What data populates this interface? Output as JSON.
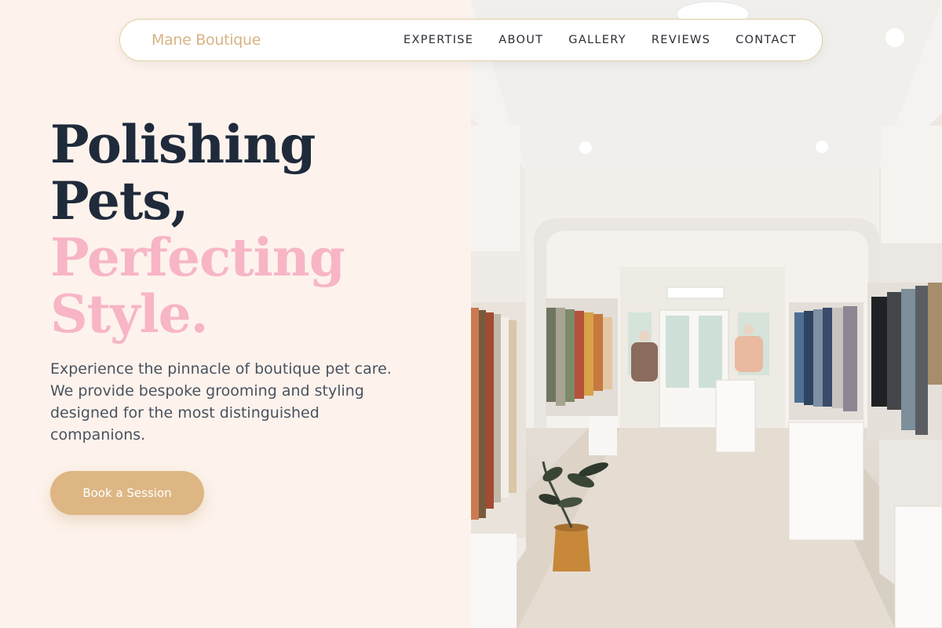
{
  "nav": {
    "brand": "Mane Boutique",
    "links": [
      {
        "label": "EXPERTISE"
      },
      {
        "label": "ABOUT"
      },
      {
        "label": "GALLERY"
      },
      {
        "label": "REVIEWS"
      },
      {
        "label": "CONTACT"
      }
    ]
  },
  "hero": {
    "headline_line1": "Polishing",
    "headline_line2": "Pets,",
    "headline_line3": "Perfecting",
    "headline_line4": "Style.",
    "description": "Experience the pinnacle of boutique pet care. We provide bespoke grooming and styling designed for the most distinguished companions.",
    "cta_label": "Book a Session"
  },
  "colors": {
    "background": "#fdf3ec",
    "heading_dark": "#1f2a3b",
    "heading_pink": "#f7b5c6",
    "accent_gold": "#ddb684",
    "brand_text": "#d7b484"
  },
  "image": {
    "description_icon": "boutique-interior-photo"
  }
}
